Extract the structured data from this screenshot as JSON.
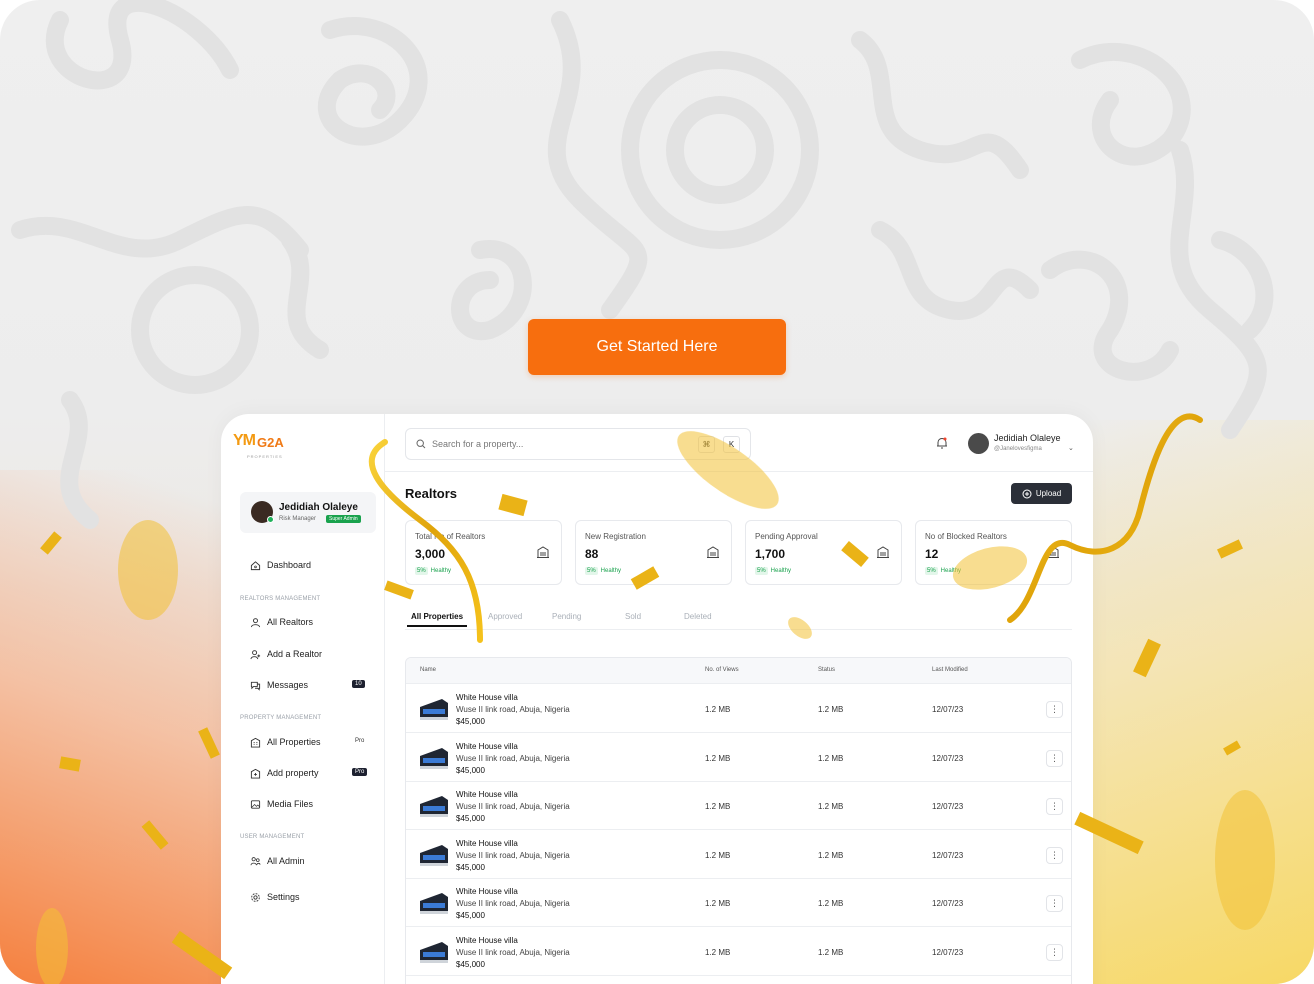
{
  "cta": {
    "label": "Get Started Here"
  },
  "brand": {
    "logo_mark": "YM",
    "logo_text": "G2A",
    "logo_sub": "PROPERTIES"
  },
  "colors": {
    "accent": "#f76e0e",
    "success": "#19a24d",
    "dark": "#1d2130"
  },
  "profile": {
    "name": "Jedidiah Olaleye",
    "role": "Risk Manager",
    "badge": "Super Admin"
  },
  "sidebar": {
    "dashboard": "Dashboard",
    "realtors_section": "REALTORS MANAGEMENT",
    "all_realtors": "All Realtors",
    "add_realtor": "Add a Realtor",
    "messages": "Messages",
    "messages_count": "10",
    "property_section": "PROPERTY MANAGEMENT",
    "all_properties": "All Properties",
    "all_properties_badge": "Pro",
    "add_property": "Add property",
    "add_property_badge": "Pro",
    "media_files": "Media Files",
    "user_section": "USER MANAGEMENT",
    "all_admin": "All Admin",
    "settings": "Settings"
  },
  "search": {
    "placeholder": "Search for a property...",
    "shortcut_1": "⌘",
    "shortcut_2": "K"
  },
  "user": {
    "name": "Jedidiah Olaleye",
    "handle": "@Janelovesfigma"
  },
  "page": {
    "title": "Realtors",
    "upload_label": "Upload"
  },
  "stats": [
    {
      "label": "Total No of Realtors",
      "value": "3,000",
      "change": "5%",
      "status": "Healthy"
    },
    {
      "label": "New Registration",
      "value": "88",
      "change": "5%",
      "status": "Healthy"
    },
    {
      "label": "Pending Approval",
      "value": "1,700",
      "change": "5%",
      "status": "Healthy"
    },
    {
      "label": "No of Blocked Realtors",
      "value": "12",
      "change": "5%",
      "status": "Healthy"
    }
  ],
  "tabs": [
    "All Properties",
    "Approved",
    "Pending",
    "Sold",
    "Deleted"
  ],
  "table": {
    "columns": [
      "Name",
      "No. of Views",
      "Status",
      "Last Modified"
    ],
    "rows": [
      {
        "title": "White House villa",
        "address": "Wuse II link road, Abuja, Nigeria",
        "price": "$45,000",
        "views": "1.2 MB",
        "status": "1.2 MB",
        "modified": "12/07/23"
      },
      {
        "title": "White House villa",
        "address": "Wuse II link road, Abuja, Nigeria",
        "price": "$45,000",
        "views": "1.2 MB",
        "status": "1.2 MB",
        "modified": "12/07/23"
      },
      {
        "title": "White House villa",
        "address": "Wuse II link road, Abuja, Nigeria",
        "price": "$45,000",
        "views": "1.2 MB",
        "status": "1.2 MB",
        "modified": "12/07/23"
      },
      {
        "title": "White House villa",
        "address": "Wuse II link road, Abuja, Nigeria",
        "price": "$45,000",
        "views": "1.2 MB",
        "status": "1.2 MB",
        "modified": "12/07/23"
      },
      {
        "title": "White House villa",
        "address": "Wuse II link road, Abuja, Nigeria",
        "price": "$45,000",
        "views": "1.2 MB",
        "status": "1.2 MB",
        "modified": "12/07/23"
      },
      {
        "title": "White House villa",
        "address": "Wuse II link road, Abuja, Nigeria",
        "price": "$45,000",
        "views": "1.2 MB",
        "status": "1.2 MB",
        "modified": "12/07/23"
      }
    ]
  }
}
